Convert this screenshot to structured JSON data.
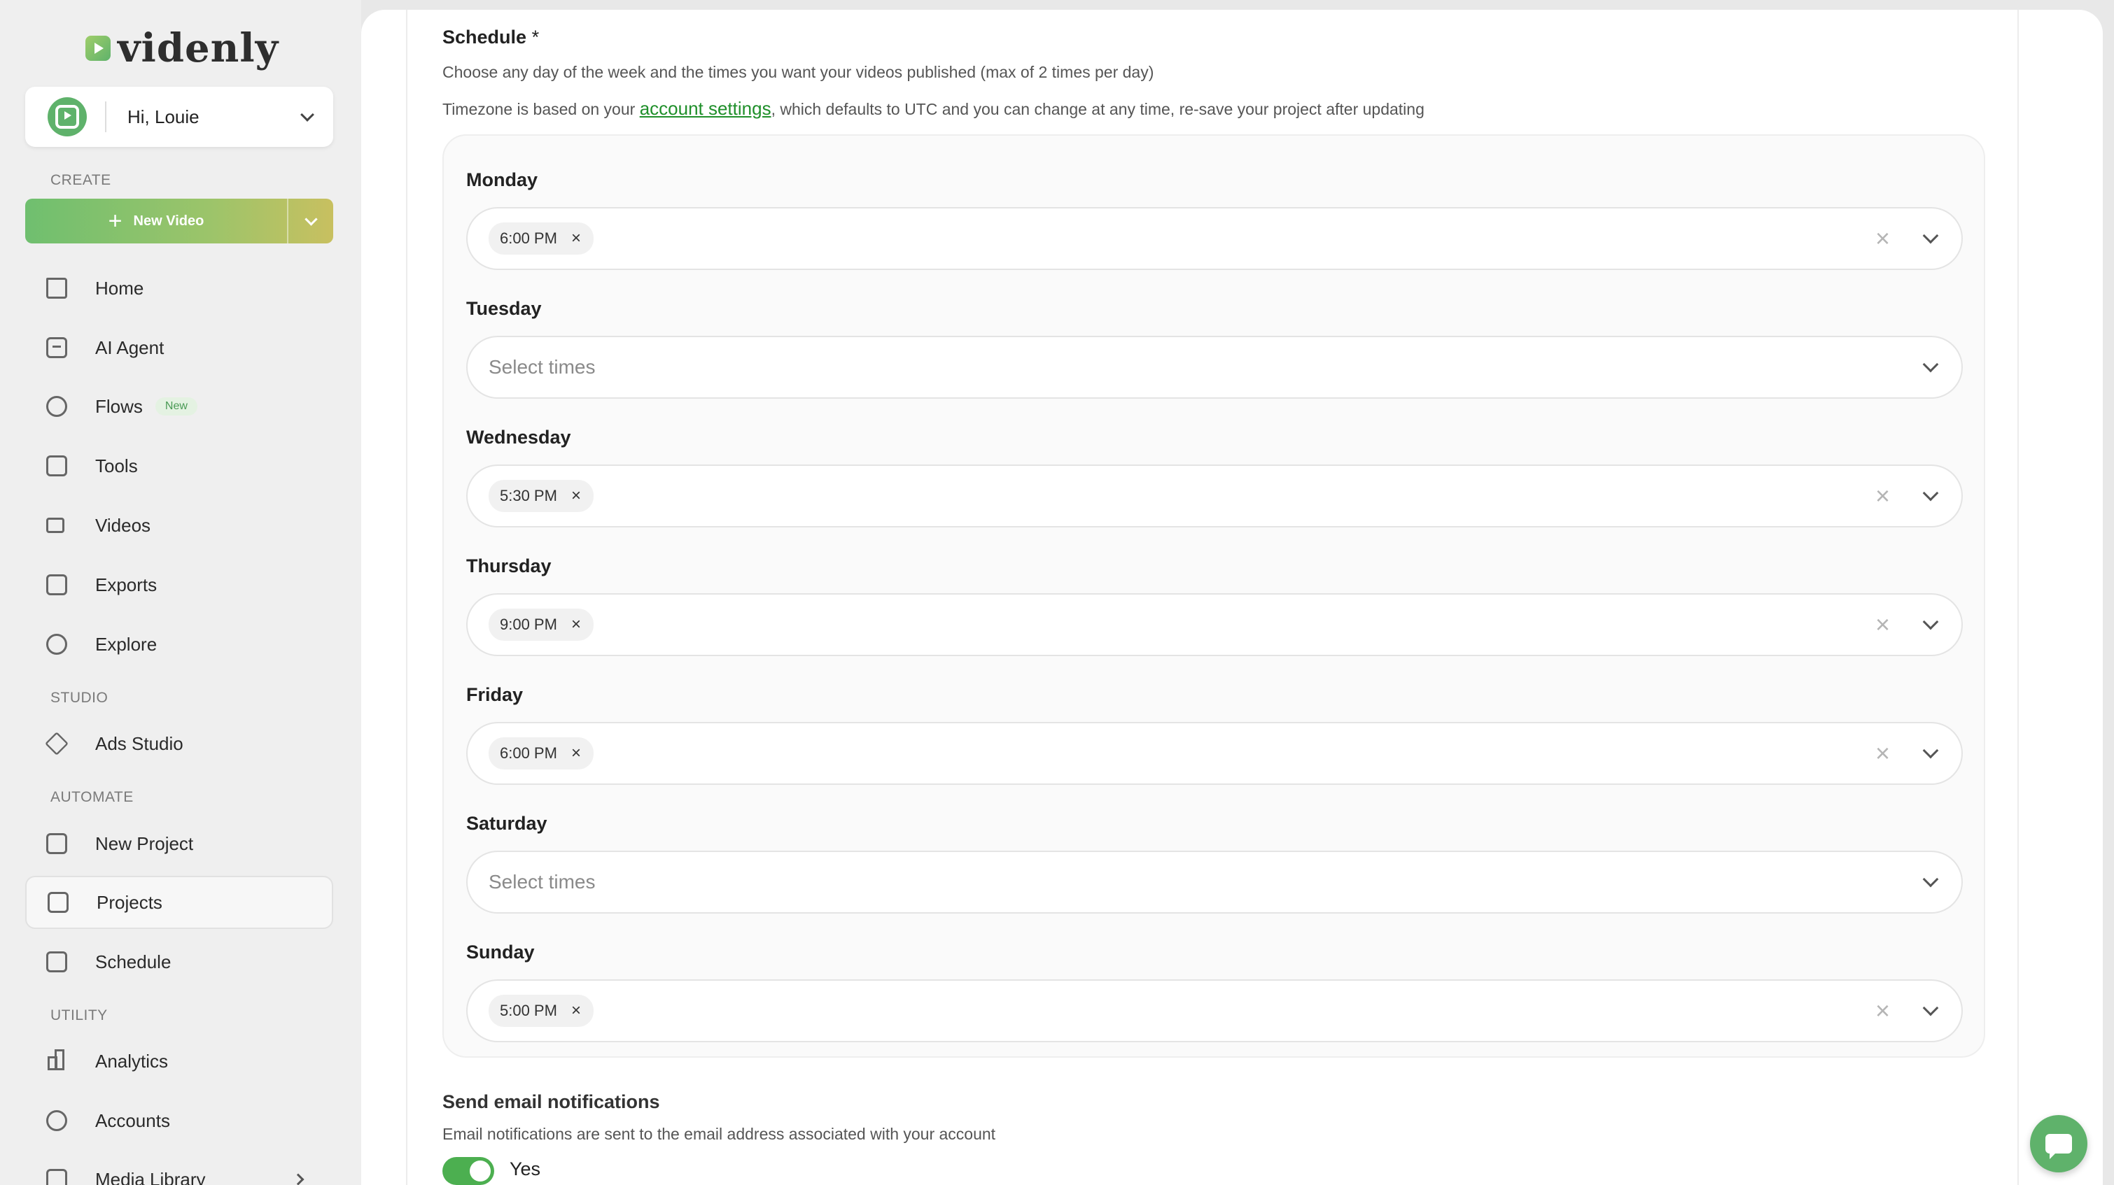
{
  "brand": {
    "name": "videnly",
    "accent": "#5fb26b",
    "link_color": "#1f8f2a"
  },
  "user": {
    "greeting": "Hi, Louie"
  },
  "sidebar": {
    "sections": {
      "create": "CREATE",
      "studio": "STUDIO",
      "automate": "AUTOMATE",
      "utility": "UTILITY"
    },
    "new_video_label": "New Video",
    "items": [
      {
        "label": "Home",
        "icon": "home-icon"
      },
      {
        "label": "AI Agent",
        "icon": "chat-icon"
      },
      {
        "label": "Flows",
        "icon": "flows-icon",
        "badge": "New"
      },
      {
        "label": "Tools",
        "icon": "tools-icon"
      },
      {
        "label": "Videos",
        "icon": "video-icon"
      },
      {
        "label": "Exports",
        "icon": "export-icon"
      },
      {
        "label": "Explore",
        "icon": "compass-icon"
      },
      {
        "label": "Ads Studio",
        "icon": "diamond-icon"
      },
      {
        "label": "New Project",
        "icon": "folder-plus-icon"
      },
      {
        "label": "Projects",
        "icon": "archive-icon",
        "active": true
      },
      {
        "label": "Schedule",
        "icon": "calendar-icon"
      },
      {
        "label": "Analytics",
        "icon": "bar-chart-icon"
      },
      {
        "label": "Accounts",
        "icon": "plug-icon"
      },
      {
        "label": "Media Library",
        "icon": "library-icon"
      }
    ]
  },
  "schedule": {
    "title": "Schedule",
    "required_mark": "*",
    "help_1": "Choose any day of the week and the times you want your videos published (max of 2 times per day)",
    "help_2_before": "Timezone is based on your ",
    "help_2_link": "account settings",
    "help_2_after": ", which defaults to UTC and you can change at any time, re-save your project after updating",
    "placeholder": "Select times",
    "days": [
      {
        "name": "Monday",
        "time": "6:00 PM"
      },
      {
        "name": "Tuesday",
        "time": ""
      },
      {
        "name": "Wednesday",
        "time": "5:30 PM"
      },
      {
        "name": "Thursday",
        "time": "9:00 PM"
      },
      {
        "name": "Friday",
        "time": "6:00 PM"
      },
      {
        "name": "Saturday",
        "time": ""
      },
      {
        "name": "Sunday",
        "time": "5:00 PM"
      }
    ]
  },
  "email": {
    "title": "Send email notifications",
    "help": "Email notifications are sent to the email address associated with your account",
    "toggle_label": "Yes"
  }
}
